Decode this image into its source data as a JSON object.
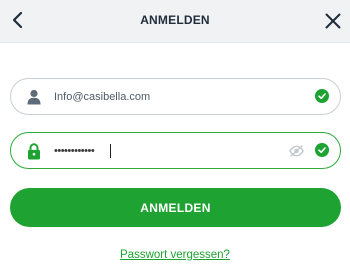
{
  "header": {
    "title": "ANMELDEN",
    "back_icon": "chevron-left-icon",
    "close_icon": "close-icon"
  },
  "email_field": {
    "value": "Info@casibella.com",
    "icon": "user-icon",
    "status_icon": "check-circle-icon"
  },
  "password_field": {
    "value": "••••••••••••",
    "icon": "lock-icon",
    "visibility_icon": "eye-off-icon",
    "status_icon": "check-circle-icon"
  },
  "login_button": {
    "label": "ANMELDEN"
  },
  "forgot_link": {
    "label": "Passwort vergessen?"
  },
  "colors": {
    "accent": "#1ea332",
    "header_bg": "#f1f2f4",
    "title_text": "#1f2c3b",
    "field_border": "#c9ced4"
  }
}
